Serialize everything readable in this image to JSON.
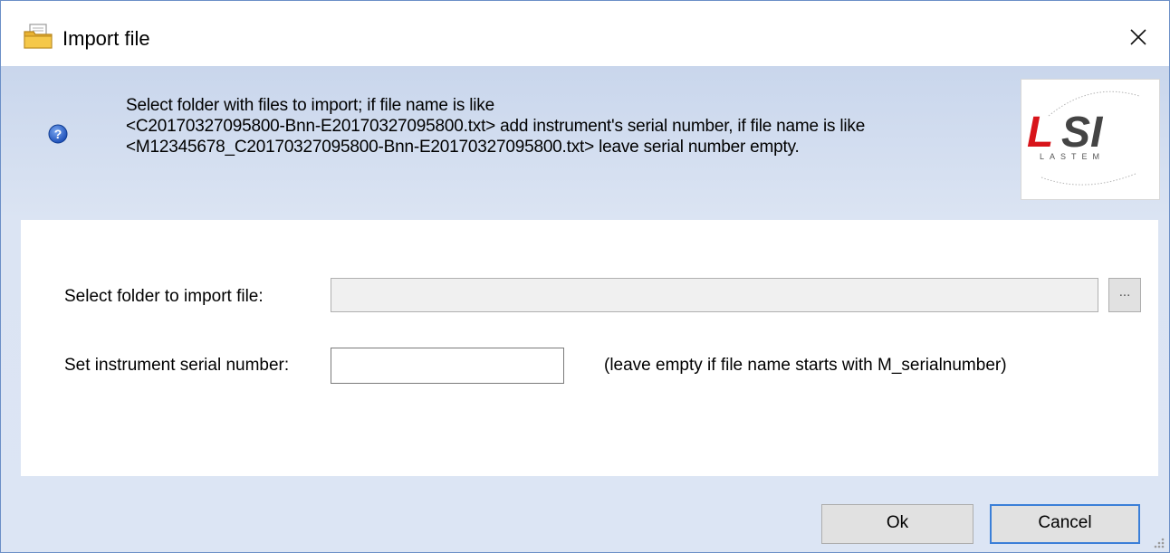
{
  "window": {
    "title": "Import file",
    "icon": "folder-document-icon",
    "close_icon": "close-icon"
  },
  "header": {
    "help_icon": "help-icon",
    "description_lines": [
      "Select folder with files to import; if file name is like",
      "<C20170327095800-Bnn-E20170327095800.txt> add instrument's serial number, if file name is like",
      "<M12345678_C20170327095800-Bnn-E20170327095800.txt> leave serial number empty."
    ],
    "logo": {
      "brand": "LSI",
      "sub": "L A S T E M",
      "colors": {
        "red": "#d8141a",
        "gray": "#444444"
      }
    }
  },
  "form": {
    "folder_label": "Select folder to import file:",
    "folder_value": "",
    "browse_label": "...",
    "serial_label": "Set instrument serial number:",
    "serial_value": "",
    "serial_hint": "(leave empty if file name starts with M_serialnumber)"
  },
  "buttons": {
    "ok": "Ok",
    "cancel": "Cancel"
  },
  "colors": {
    "header_bg": "#c9d6ec",
    "default_button_border": "#3b7fd8"
  }
}
